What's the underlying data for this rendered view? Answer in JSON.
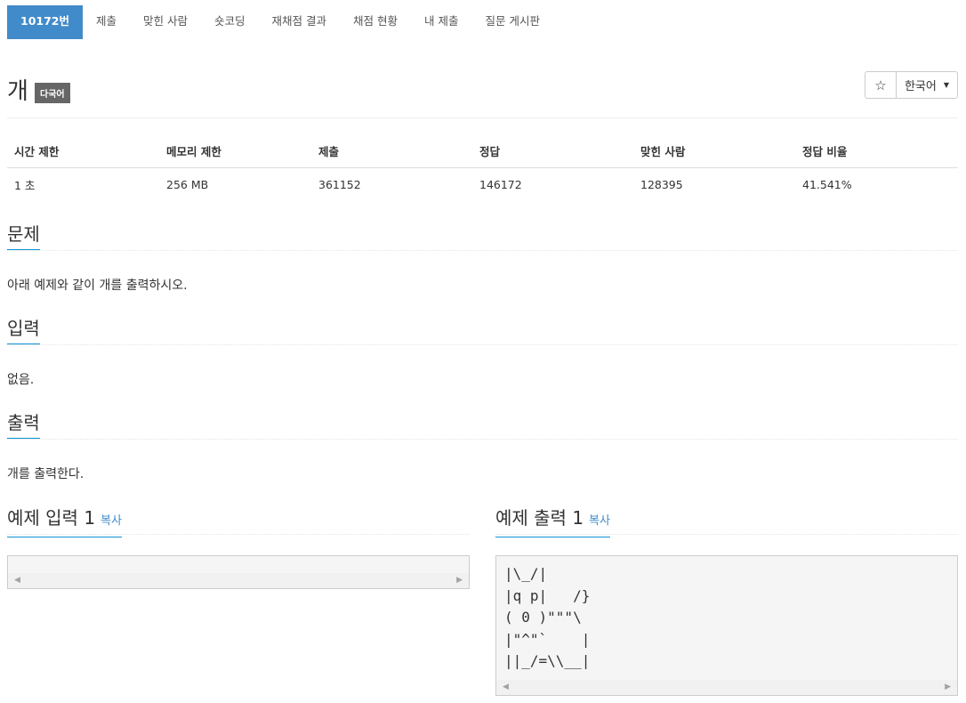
{
  "nav": {
    "tabs": [
      "10172번",
      "제출",
      "맞힌 사람",
      "숏코딩",
      "재채점 결과",
      "채점 현황",
      "내 제출",
      "질문 게시판"
    ],
    "active": 0
  },
  "problem": {
    "title": "개",
    "badge": "다국어",
    "language": "한국어",
    "star_icon": "star-icon"
  },
  "info": {
    "headers": [
      "시간 제한",
      "메모리 제한",
      "제출",
      "정답",
      "맞힌 사람",
      "정답 비율"
    ],
    "values": [
      "1 초",
      "256 MB",
      "361152",
      "146172",
      "128395",
      "41.541%"
    ]
  },
  "sections": {
    "problem_title": "문제",
    "problem_text": "아래 예제와 같이 개를 출력하시오.",
    "input_title": "입력",
    "input_text": "없음.",
    "output_title": "출력",
    "output_text": "개를 출력한다."
  },
  "samples": {
    "input_title": "예제 입력 1",
    "output_title": "예제 출력 1",
    "copy_label": "복사",
    "input_content": "",
    "output_content": "|\\_/|\n|q p|   /}\n( 0 )\"\"\"\\\n|\"^\"`    |\n||_/=\\\\__|"
  },
  "colors": {
    "active_tab": "#428bca",
    "accent": "#0e90d2",
    "link": "#428bca"
  }
}
